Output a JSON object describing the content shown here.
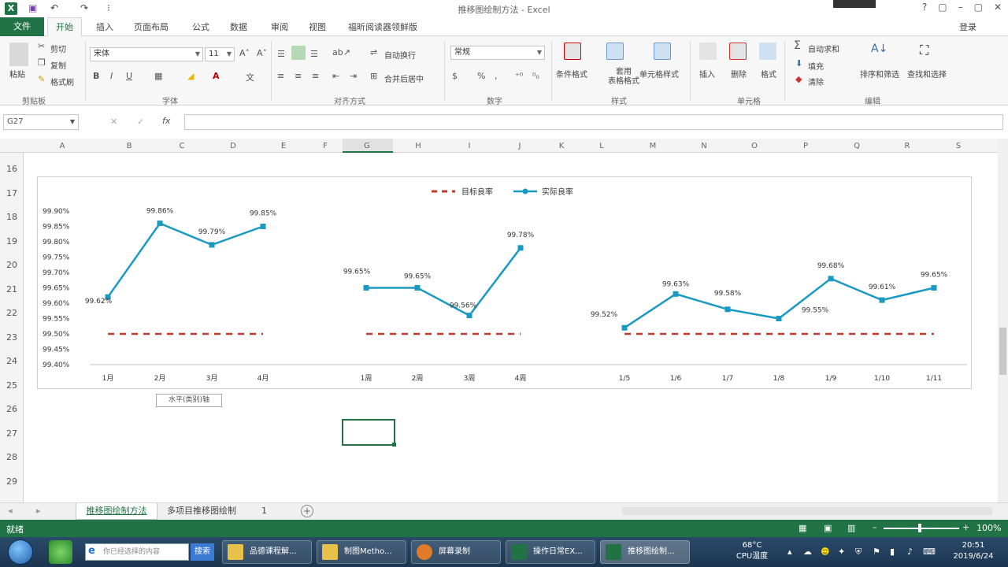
{
  "window": {
    "title": "推移图绘制方法 - Excel",
    "controls": [
      "?",
      "▢",
      "–",
      "▢",
      "✕"
    ]
  },
  "qat": {
    "undo": "↶",
    "redo": "↷",
    "more": "⁝"
  },
  "tabs": {
    "file": "文件",
    "home": "开始",
    "items": [
      "插入",
      "页面布局",
      "公式",
      "数据",
      "审阅",
      "视图",
      "福昕阅读器领鲜版"
    ],
    "login": "登录"
  },
  "ribbon": {
    "clipboard": {
      "label": "剪贴板",
      "paste": "粘贴",
      "cut": "剪切",
      "copy": "复制",
      "painter": "格式刷"
    },
    "font": {
      "label": "字体",
      "name": "宋体",
      "size": "11"
    },
    "alignment": {
      "label": "对齐方式",
      "wrap": "自动换行",
      "merge": "合并后居中"
    },
    "number": {
      "label": "数字",
      "format": "常规"
    },
    "styles": {
      "label": "样式",
      "cond": "条件格式",
      "table": "套用\n表格格式",
      "cell": "单元格样式"
    },
    "cells": {
      "label": "单元格",
      "insert": "插入",
      "delete": "删除",
      "format": "格式"
    },
    "editing": {
      "label": "编辑",
      "autosum": "自动求和",
      "fill": "填充",
      "clear": "清除",
      "sort": "排序和筛选",
      "find": "查找和选择"
    }
  },
  "formula_bar": {
    "name_box": "G27",
    "cancel": "✕",
    "enter": "✓",
    "fx": "fx"
  },
  "columns": [
    "A",
    "B",
    "C",
    "D",
    "E",
    "F",
    "G",
    "H",
    "I",
    "J",
    "K",
    "L",
    "M",
    "N",
    "O",
    "P",
    "Q",
    "R",
    "S"
  ],
  "rows": [
    "16",
    "17",
    "18",
    "19",
    "20",
    "21",
    "22",
    "23",
    "24",
    "25",
    "26",
    "27",
    "28",
    "29"
  ],
  "chart_data": {
    "type": "line",
    "legend": [
      "目标良率",
      "实际良率"
    ],
    "legend_position": "top",
    "y_ticks": [
      "99.90%",
      "99.85%",
      "99.80%",
      "99.75%",
      "99.70%",
      "99.65%",
      "99.60%",
      "99.55%",
      "99.50%",
      "99.45%",
      "99.40%"
    ],
    "ylim": [
      99.4,
      99.9
    ],
    "target": 99.5,
    "series": [
      {
        "categories": [
          "1月",
          "2月",
          "3月",
          "4月"
        ],
        "values": [
          99.62,
          99.86,
          99.79,
          99.85
        ],
        "labels": [
          "99.62%",
          "99.86%",
          "99.79%",
          "99.85%"
        ]
      },
      {
        "categories": [
          "1周",
          "2周",
          "3周",
          "4周"
        ],
        "values": [
          99.65,
          99.65,
          99.56,
          99.78
        ],
        "labels": [
          "99.65%",
          "99.65%",
          "99.56%",
          "99.78%"
        ]
      },
      {
        "categories": [
          "1/5",
          "1/6",
          "1/7",
          "1/8",
          "1/9",
          "1/10",
          "1/11"
        ],
        "values": [
          99.52,
          99.63,
          99.58,
          99.55,
          99.68,
          99.61,
          99.65
        ],
        "labels": [
          "99.52%",
          "99.63%",
          "99.58%",
          "99.55%",
          "99.68%",
          "99.61%",
          "99.65%"
        ]
      }
    ],
    "colors": {
      "actual": "#1a9ac2",
      "target": "#c0392b"
    },
    "axis_tooltip": "水平(类别)轴"
  },
  "sheets": {
    "active": "推移图绘制方法",
    "other": "多项目推移图绘制",
    "more": "1",
    "add": "+"
  },
  "status": {
    "ready": "就绪",
    "zoom": "100%"
  },
  "taskbar": {
    "search_placeholder": "你已经选择的内容",
    "search_btn": "搜索",
    "items": [
      "品德课程解...",
      "制图Metho...",
      "屏幕录制",
      "操作日常EX...",
      "推移图绘制..."
    ],
    "temp": "68°C",
    "temp_label": "CPU温度",
    "time": "20:51",
    "date": "2019/6/24"
  },
  "colors": {
    "excel_green": "#217346"
  }
}
